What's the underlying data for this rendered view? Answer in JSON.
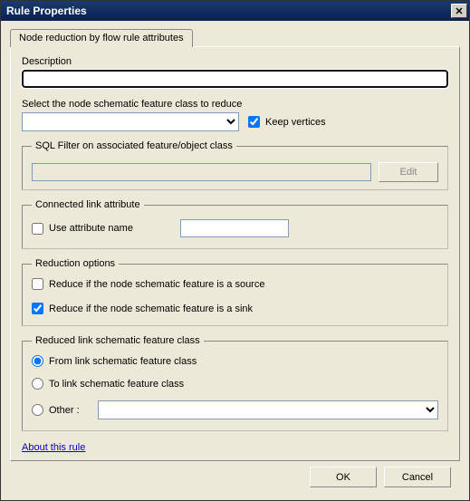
{
  "window": {
    "title": "Rule Properties",
    "close": "X"
  },
  "tab": {
    "label": "Node reduction by flow rule attributes"
  },
  "description": {
    "label": "Description",
    "value": ""
  },
  "featureClass": {
    "label": "Select the node schematic feature class to reduce",
    "value": "",
    "keepVerticesLabel": "Keep vertices",
    "keepVertices": true
  },
  "sqlFilter": {
    "legend": "SQL Filter on associated feature/object class",
    "value": "",
    "editLabel": "Edit"
  },
  "connectedLink": {
    "legend": "Connected link attribute",
    "useAttrLabel": "Use attribute name",
    "useAttr": false,
    "attrValue": ""
  },
  "reduction": {
    "legend": "Reduction options",
    "sourceLabel": "Reduce if the node schematic feature is a source",
    "source": false,
    "sinkLabel": "Reduce if the node schematic feature is a sink",
    "sink": true
  },
  "reducedLink": {
    "legend": "Reduced link schematic feature class",
    "fromLabel": "From link schematic feature class",
    "toLabel": "To link schematic feature class",
    "otherLabel": "Other :",
    "selected": "from",
    "otherValue": ""
  },
  "aboutLink": "About this rule",
  "buttons": {
    "ok": "OK",
    "cancel": "Cancel"
  }
}
